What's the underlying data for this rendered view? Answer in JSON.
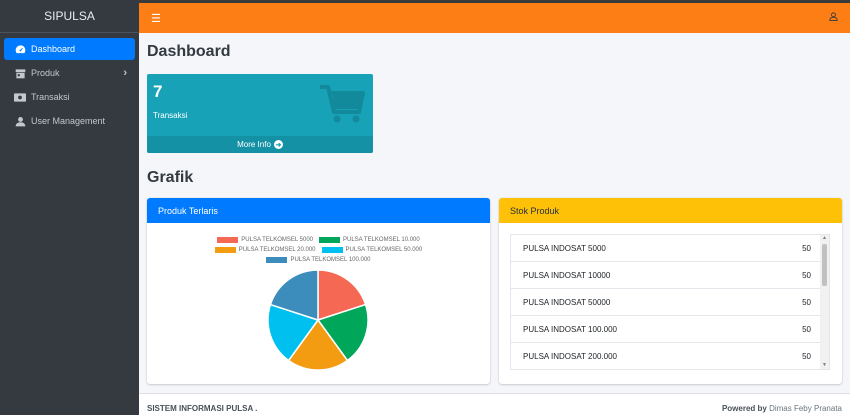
{
  "brand": "SIPULSA",
  "sidebar": {
    "items": [
      {
        "label": "Dashboard",
        "icon": "dashboard-icon",
        "active": true
      },
      {
        "label": "Produk",
        "icon": "store-icon",
        "has_children": true
      },
      {
        "label": "Transaksi",
        "icon": "money-icon"
      },
      {
        "label": "User Management",
        "icon": "user-icon"
      }
    ]
  },
  "topbar": {
    "menu_icon": "hamburger-icon",
    "user_icon": "user-icon",
    "color": "#fd7e14"
  },
  "page_title": "Dashboard",
  "stat_box": {
    "value": "7",
    "caption": "Transaksi",
    "more_label": "More Info",
    "icon": "cart-icon",
    "color": "#17a2b8"
  },
  "section_title": "Grafik",
  "chart_card": {
    "title": "Produk Terlaris",
    "color": "#007bff"
  },
  "chart_data": {
    "type": "pie",
    "legend_rows": [
      [
        "PULSA TELKOMSEL 5000",
        "PULSA TELKOMSEL 10.000"
      ],
      [
        "PULSA TELKOMSEL 20.000",
        "PULSA TELKOMSEL 50.000"
      ],
      [
        "PULSA TELKOMSEL 100.000"
      ]
    ],
    "legend_placement": "top",
    "slices": [
      {
        "label": "PULSA TELKOMSEL 5000",
        "value": 1,
        "color": "#f56954"
      },
      {
        "label": "PULSA TELKOMSEL 10.000",
        "value": 1,
        "color": "#00a65a"
      },
      {
        "label": "PULSA TELKOMSEL 20.000",
        "value": 1,
        "color": "#f39c12"
      },
      {
        "label": "PULSA TELKOMSEL 50.000",
        "value": 1,
        "color": "#00c0ef"
      },
      {
        "label": "PULSA TELKOMSEL 100.000",
        "value": 1,
        "color": "#3c8dbc"
      }
    ]
  },
  "stock_card": {
    "title": "Stok Produk",
    "color": "#ffc107",
    "items": [
      {
        "name": "PULSA INDOSAT 5000",
        "qty": "50"
      },
      {
        "name": "PULSA INDOSAT 10000",
        "qty": "50"
      },
      {
        "name": "PULSA INDOSAT 50000",
        "qty": "50"
      },
      {
        "name": "PULSA INDOSAT 100.000",
        "qty": "50"
      },
      {
        "name": "PULSA INDOSAT 200.000",
        "qty": "50"
      }
    ]
  },
  "footer": {
    "left": "SISTEM INFORMASI PULSA .",
    "powered_label": "Powered by",
    "powered_name": "Dimas Feby Pranata"
  }
}
